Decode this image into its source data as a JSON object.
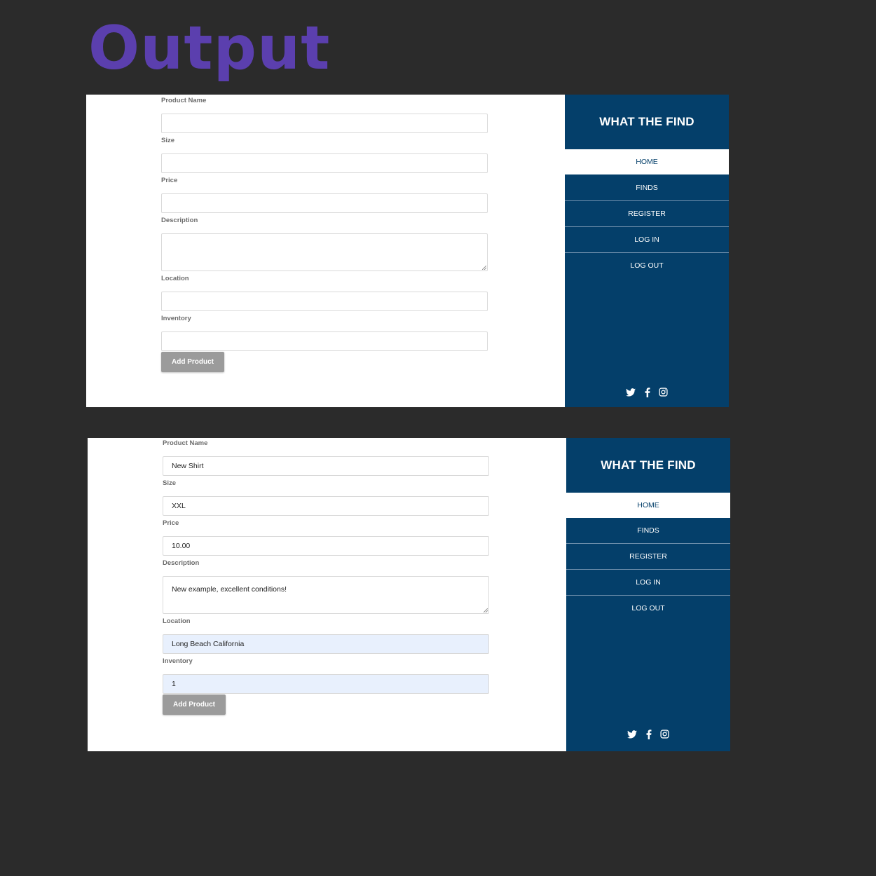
{
  "heading": "Output",
  "brand": "WHAT THE FIND",
  "nav": [
    "HOME",
    "FINDS",
    "REGISTER",
    "LOG IN",
    "LOG OUT"
  ],
  "labels": {
    "product_name": "Product Name",
    "size": "Size",
    "price": "Price",
    "description": "Description",
    "location": "Location",
    "inventory": "Inventory"
  },
  "button": "Add Product",
  "filled": {
    "product_name": "New Shirt",
    "size": "XXL",
    "price": "10.00",
    "description": "New example, excellent conditions!",
    "location": "Long Beach California",
    "inventory": "1"
  },
  "colors": {
    "sidebar": "#043f6a",
    "heading": "#5b3fae",
    "button": "#9b9b9b",
    "autofill": "#e8f0fd"
  },
  "icons": [
    "twitter-icon",
    "facebook-icon",
    "instagram-icon"
  ]
}
